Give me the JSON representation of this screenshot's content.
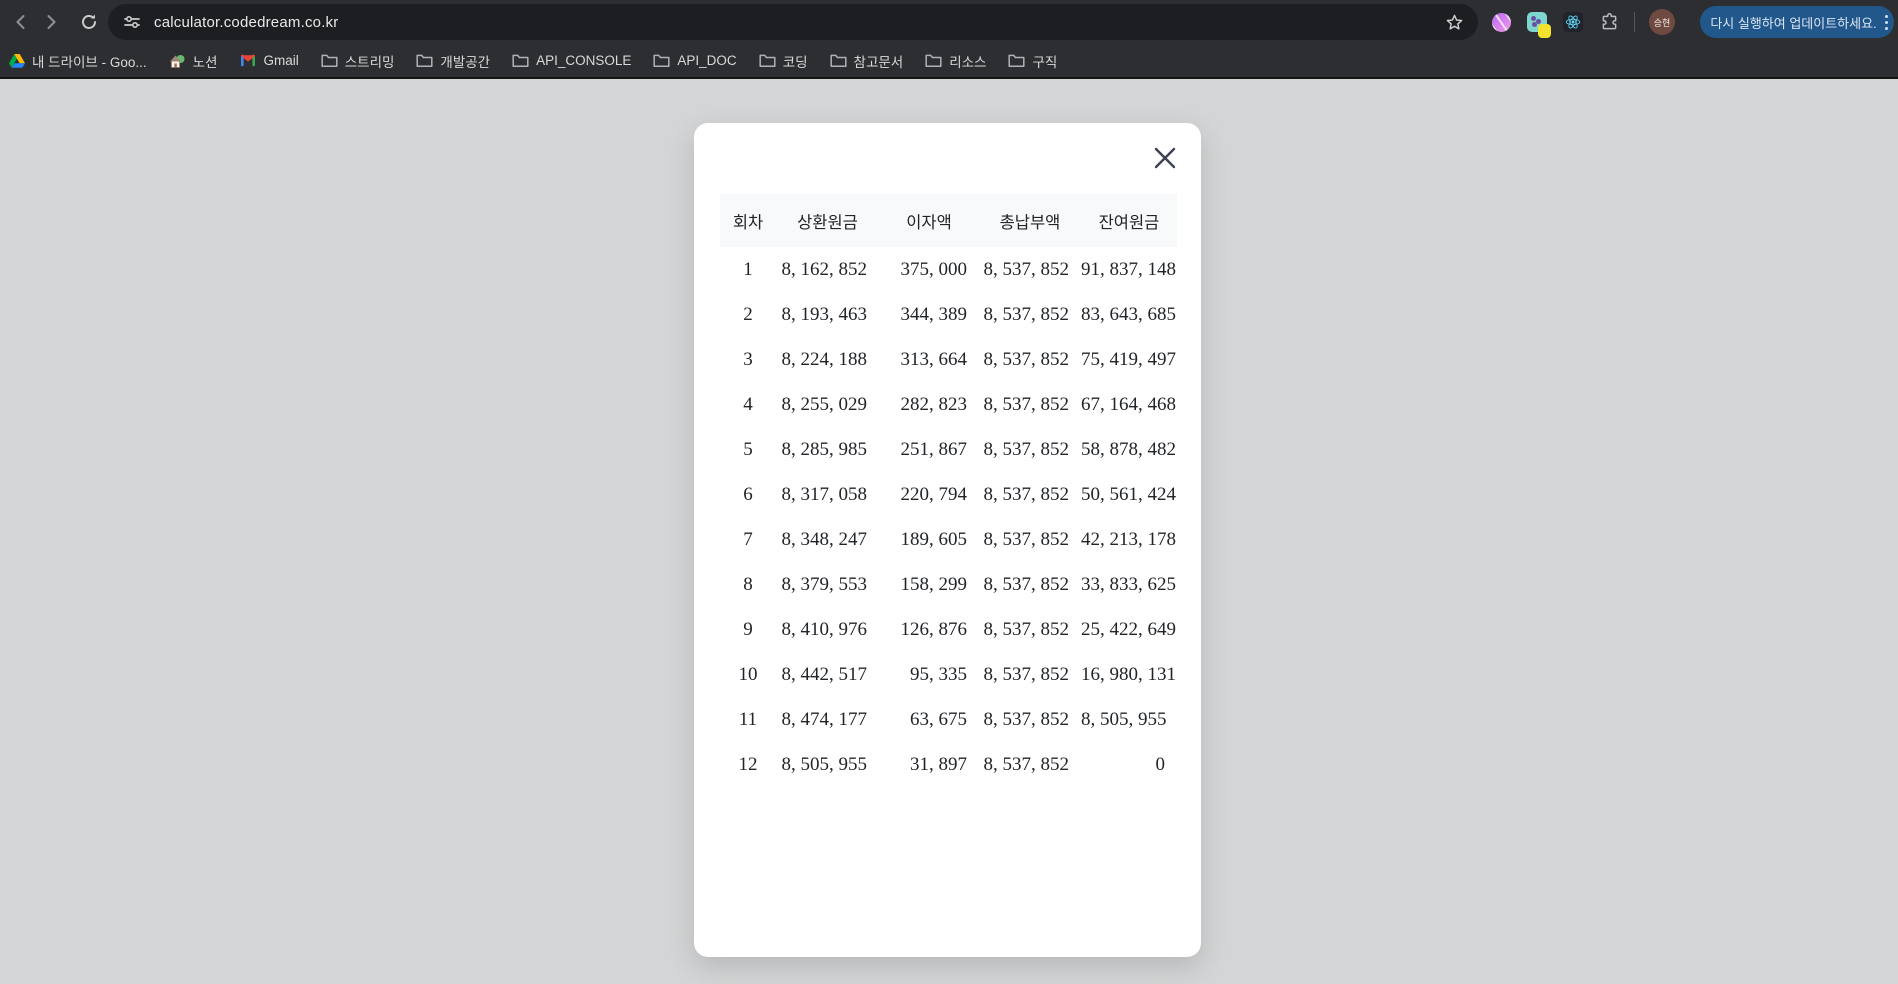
{
  "browser": {
    "url": "calculator.codedream.co.kr",
    "profile_initials": "승현",
    "update_button_label": "다시 실행하여 업데이트하세요.",
    "bookmarks": [
      {
        "label": "내 드라이브 - Goo...",
        "icon": "drive"
      },
      {
        "label": "노션",
        "icon": "house"
      },
      {
        "label": "Gmail",
        "icon": "gmail"
      },
      {
        "label": "스트리밍",
        "icon": "folder"
      },
      {
        "label": "개발공간",
        "icon": "folder"
      },
      {
        "label": "API_CONSOLE",
        "icon": "folder"
      },
      {
        "label": "API_DOC",
        "icon": "folder"
      },
      {
        "label": "코딩",
        "icon": "folder"
      },
      {
        "label": "참고문서",
        "icon": "folder"
      },
      {
        "label": "리소스",
        "icon": "folder"
      },
      {
        "label": "구직",
        "icon": "folder"
      }
    ]
  },
  "modal": {
    "table": {
      "headers": [
        "회차",
        "상환원금",
        "이자액",
        "총납부액",
        "잔여원금"
      ],
      "rows": [
        [
          "1",
          "8, 162, 852",
          "375, 000",
          "8, 537, 852",
          "91, 837, 148"
        ],
        [
          "2",
          "8, 193, 463",
          "344, 389",
          "8, 537, 852",
          "83, 643, 685"
        ],
        [
          "3",
          "8, 224, 188",
          "313, 664",
          "8, 537, 852",
          "75, 419, 497"
        ],
        [
          "4",
          "8, 255, 029",
          "282, 823",
          "8, 537, 852",
          "67, 164, 468"
        ],
        [
          "5",
          "8, 285, 985",
          "251, 867",
          "8, 537, 852",
          "58, 878, 482"
        ],
        [
          "6",
          "8, 317, 058",
          "220, 794",
          "8, 537, 852",
          "50, 561, 424"
        ],
        [
          "7",
          "8, 348, 247",
          "189, 605",
          "8, 537, 852",
          "42, 213, 178"
        ],
        [
          "8",
          "8, 379, 553",
          "158, 299",
          "8, 537, 852",
          "33, 833, 625"
        ],
        [
          "9",
          "8, 410, 976",
          "126, 876",
          "8, 537, 852",
          "25, 422, 649"
        ],
        [
          "10",
          "8, 442, 517",
          "95, 335",
          "8, 537, 852",
          "16, 980, 131"
        ],
        [
          "11",
          "8, 474, 177",
          "63, 675",
          "8, 537, 852",
          "8, 505, 955"
        ],
        [
          "12",
          "8, 505, 955",
          "31, 897",
          "8, 537, 852",
          "0"
        ]
      ]
    }
  },
  "colors": {
    "toolbar_bg": "#2d2e31",
    "omnibox_bg": "#1d1e21",
    "page_bg": "#d4d5d6",
    "modal_bg": "#ffffff",
    "table_header_bg": "#f8f9fa",
    "text_dark": "#212529",
    "update_chip_bg": "#21578a",
    "avatar_bg": "#6f4a41"
  }
}
